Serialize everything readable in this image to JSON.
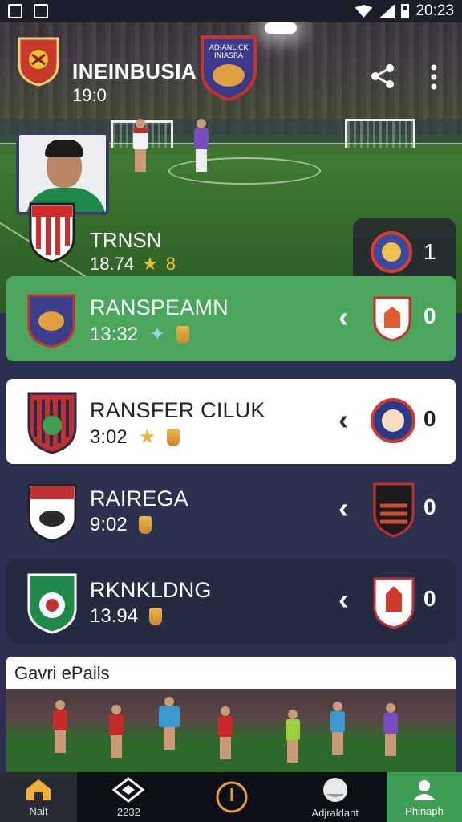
{
  "status_bar": {
    "time": "20:23"
  },
  "hero": {
    "title": "INEINBUSIA",
    "score_line": "19:0",
    "away_crest_text": [
      "ADIANLICK",
      "INIASRA"
    ],
    "team_name": "TRNSN",
    "team_time": "18.74",
    "team_rating": "8",
    "team_score": "1"
  },
  "matches": [
    {
      "team": "RANSPEAMN",
      "time": "13:32",
      "score": "0"
    },
    {
      "team": "RANSFER CILUK",
      "time": "3:02",
      "score": "0"
    },
    {
      "team": "RAIREGA",
      "time": "9:02",
      "score": "0"
    },
    {
      "team": "RKNKLDNG",
      "time": "13.94",
      "score": "0"
    }
  ],
  "gallery": {
    "title": "Gavri ePails"
  },
  "nav": [
    {
      "label": "Nalt",
      "icon": "home-icon"
    },
    {
      "label": "2232",
      "icon": "diamond-icon"
    },
    {
      "label": "",
      "icon": "timer-icon"
    },
    {
      "label": "Adjraldant",
      "icon": "ball-icon"
    },
    {
      "label": "Phinaph",
      "icon": "profile-icon"
    }
  ],
  "colors": {
    "accent_green": "#4aa55d",
    "navy": "#2c3150",
    "gold": "#e8c23a"
  }
}
